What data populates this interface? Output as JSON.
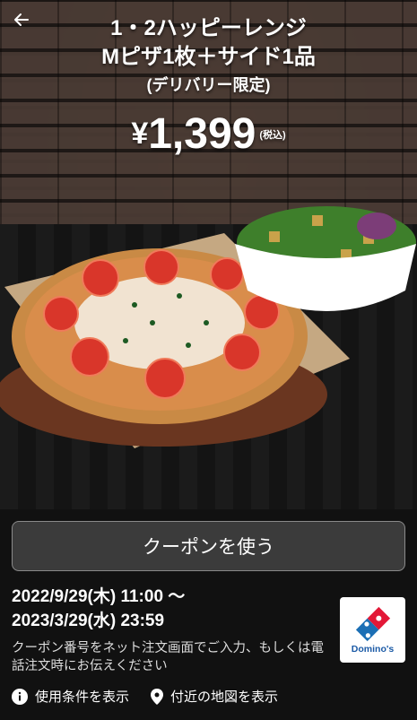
{
  "hero": {
    "title_line1": "1・2ハッピーレンジ",
    "title_line2": "Mピザ1枚＋サイド1品",
    "title_line3": "(デリバリー限定)",
    "price_symbol": "¥",
    "price_value": "1,399",
    "price_tax_note": "(税込)"
  },
  "coupon_button_label": "クーポンを使う",
  "validity": {
    "start": "2022/9/29(木) 11:00 〜",
    "end": "2023/3/29(水) 23:59"
  },
  "note": "クーポン番号をネット注文画面でご入力、もしくは電話注文時にお伝えください",
  "brand": {
    "name": "Domino's",
    "colors": {
      "blue": "#1b6fb5",
      "red": "#e31837"
    }
  },
  "footer": {
    "terms_label": "使用条件を表示",
    "map_label": "付近の地図を表示"
  },
  "icons": {
    "back": "arrow-left-icon",
    "info": "info-icon",
    "location": "map-pin-icon"
  }
}
